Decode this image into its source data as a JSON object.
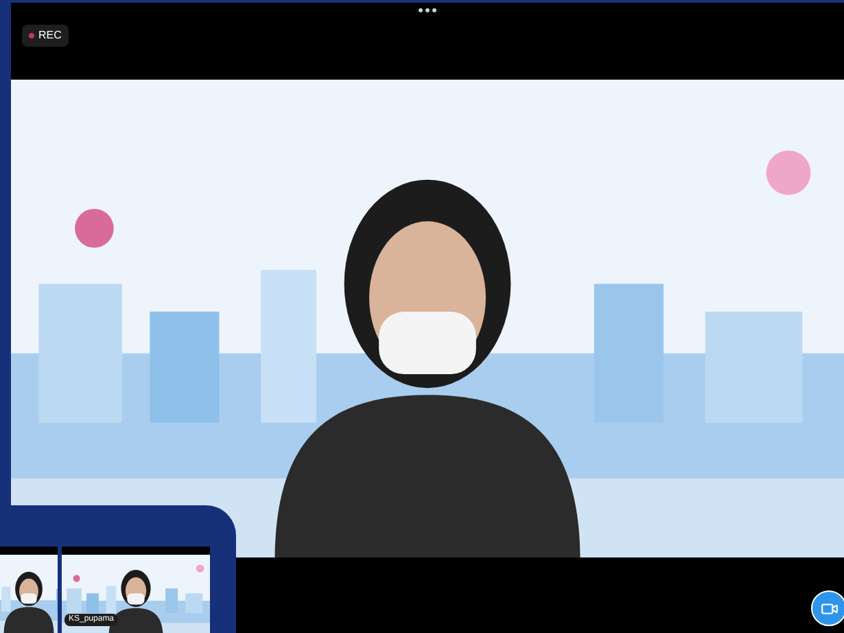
{
  "recording": {
    "label": "REC"
  },
  "main_video": {
    "kind": "picture"
  },
  "thumbnails": [
    {
      "kind": "picture"
    },
    {
      "kind": "picture",
      "name": "KS_pupama"
    }
  ]
}
